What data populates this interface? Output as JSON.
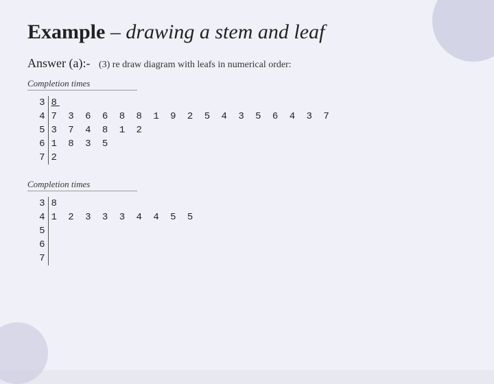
{
  "title": {
    "prefix": "Example",
    "suffix": "– drawing a stem and leaf"
  },
  "answer": {
    "label": "Answer (a):-",
    "instruction": "(3)  re draw diagram with leafs in numerical order:"
  },
  "section1": {
    "title": "Completion times",
    "rows": [
      {
        "stem": "3",
        "leaves": "8",
        "underline_first": true
      },
      {
        "stem": "4",
        "leaves": "7 3 6 6 8 8 1 9 2 5 4 3 5 6 4 3 7",
        "underline_first": false
      },
      {
        "stem": "5",
        "leaves": "3 7 4 8 1 2",
        "underline_first": false
      },
      {
        "stem": "6",
        "leaves": "1 8 3 5",
        "underline_first": false
      },
      {
        "stem": "7",
        "leaves": "2",
        "underline_first": false
      }
    ]
  },
  "section2": {
    "title": "Completion times",
    "rows": [
      {
        "stem": "3",
        "leaves": "8",
        "underline_first": false
      },
      {
        "stem": "4",
        "leaves": "1 2 3 3 3 4 4 5 5",
        "underline_first": false
      },
      {
        "stem": "5",
        "leaves": "",
        "underline_first": false
      },
      {
        "stem": "6",
        "leaves": "",
        "underline_first": false
      },
      {
        "stem": "7",
        "leaves": "",
        "underline_first": false
      }
    ]
  }
}
